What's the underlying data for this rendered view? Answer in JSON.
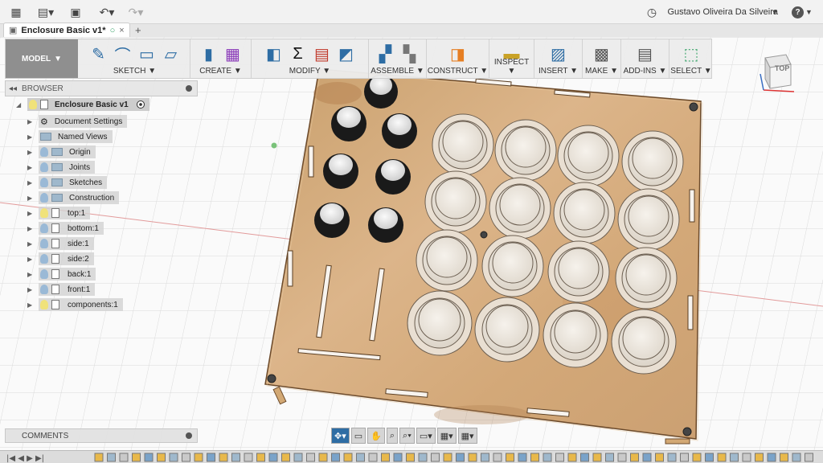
{
  "app": {
    "user_name": "Gustavo Oliveira Da Silveira",
    "help_label": "?"
  },
  "tab": {
    "title": "Enclosure Basic v1*",
    "close": "×",
    "new_tab": "+"
  },
  "toolbar": {
    "workspace": "MODEL",
    "groups": [
      {
        "label": "SKETCH"
      },
      {
        "label": "CREATE"
      },
      {
        "label": "MODIFY"
      },
      {
        "label": "ASSEMBLE"
      },
      {
        "label": "CONSTRUCT"
      },
      {
        "label": "INSPECT"
      },
      {
        "label": "INSERT"
      },
      {
        "label": "MAKE"
      },
      {
        "label": "ADD-INS"
      },
      {
        "label": "SELECT"
      }
    ]
  },
  "browser": {
    "title": "BROWSER",
    "root": "Enclosure Basic v1",
    "items": [
      {
        "label": "Document Settings"
      },
      {
        "label": "Named Views"
      },
      {
        "label": "Origin"
      },
      {
        "label": "Joints"
      },
      {
        "label": "Sketches"
      },
      {
        "label": "Construction"
      },
      {
        "label": "top:1"
      },
      {
        "label": "bottom:1"
      },
      {
        "label": "side:1"
      },
      {
        "label": "side:2"
      },
      {
        "label": "back:1"
      },
      {
        "label": "front:1"
      },
      {
        "label": "components:1"
      }
    ]
  },
  "comments": {
    "label": "COMMENTS"
  },
  "viewcube": {
    "label": "TOP"
  },
  "colors": {
    "wood": "#d8b184",
    "wood_dark": "#b98550",
    "button": "#ece6dc",
    "accent": "#2e6da4"
  }
}
